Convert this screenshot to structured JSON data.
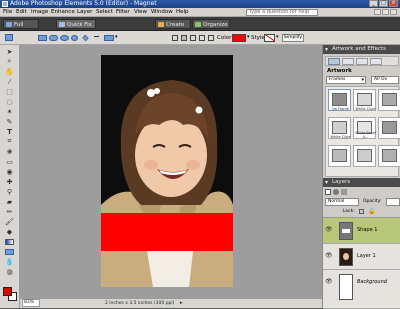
{
  "window": {
    "title": "Adobe Photoshop Elements 5.0 (Editor) - Magnet",
    "controls": [
      "_",
      "□",
      "×"
    ]
  },
  "menu": {
    "items": [
      "File",
      "Edit",
      "Image",
      "Enhance",
      "Layer",
      "Select",
      "Filter",
      "View",
      "Window",
      "Help"
    ],
    "question_placeholder": "Type a question for help"
  },
  "shortcuts": {
    "full_edit": "Full Edit",
    "quick_fix": "Quick Fix",
    "create": "Create",
    "organize": "Organize"
  },
  "options": {
    "color_label": "Color:",
    "color_value": "#ff0000",
    "style_label": "Style:",
    "simplify": "Simplify"
  },
  "artwork": {
    "panel_title": "Artwork and Effects",
    "section_title": "Artwork",
    "category_select": "Frames",
    "filter_select": "All Ov",
    "thumbnails": [
      "No Frame",
      "White Clipe",
      "",
      "White Clipe",
      "White Bevel A...",
      "",
      "",
      "",
      ""
    ]
  },
  "layers": {
    "panel_title": "Layers",
    "blend_mode": "Normal",
    "opacity_label": "Opacity:",
    "lock_label": "Lock:",
    "items": [
      {
        "name": "Shape 1",
        "selected": true
      },
      {
        "name": "Layer 1",
        "selected": false
      },
      {
        "name": "Background",
        "selected": false
      }
    ]
  },
  "status": {
    "zoom": "83%",
    "doc_size": "2 inches x 3.5 inches (300 ppi)"
  },
  "colors": {
    "foreground": "#e00000",
    "background": "#ffffff",
    "shape_fill": "#ff0000"
  }
}
